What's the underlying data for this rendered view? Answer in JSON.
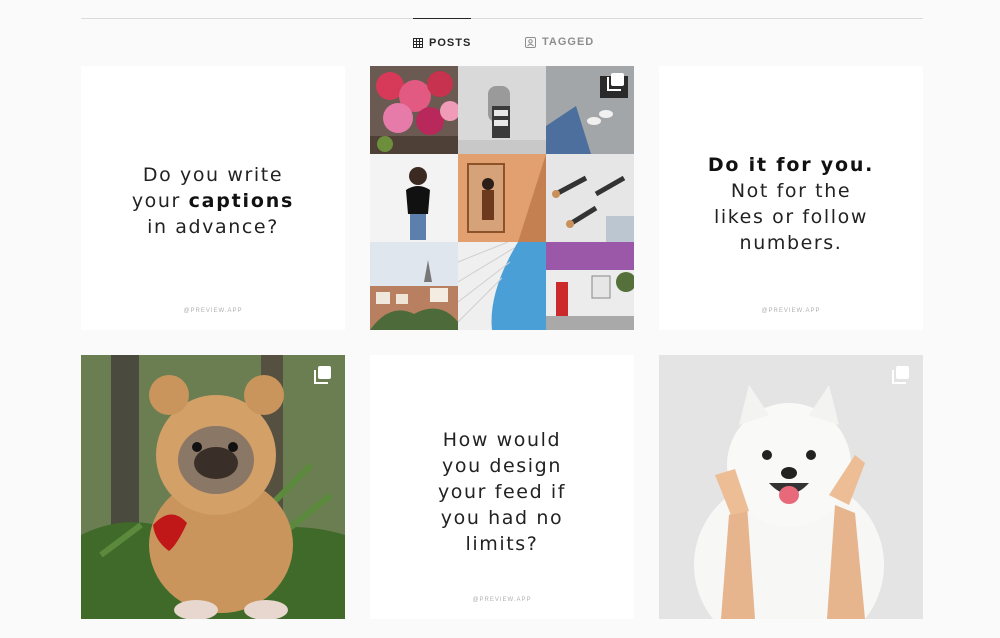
{
  "tabs": [
    {
      "label": "POSTS",
      "active": true
    },
    {
      "label": "TAGGED",
      "active": false
    }
  ],
  "posts": {
    "captions_quote": {
      "line1": "Do you write",
      "line2_pre": "your ",
      "line2_bold": "captions",
      "line3": "in advance?",
      "watermark": "@PREVIEW.APP"
    },
    "collage": {
      "type": "photo-grid",
      "multiple": true
    },
    "do_it_quote": {
      "line1_bold": "Do it for you.",
      "line2": "Not for the",
      "line3": "likes or follow",
      "line4": "numbers.",
      "watermark": "@PREVIEW.APP"
    },
    "dog_photo": {
      "type": "photo",
      "multiple": true
    },
    "design_quote": {
      "line1": "How would",
      "line2": "you design",
      "line3": "your feed if",
      "line4": "you had no",
      "line5": "limits?",
      "watermark": "@PREVIEW.APP"
    },
    "samoyed_photo": {
      "type": "photo",
      "multiple": true
    }
  },
  "colors": {
    "background": "#fafafa",
    "active_tab": "#262626",
    "inactive_tab": "#8e8e8e"
  }
}
